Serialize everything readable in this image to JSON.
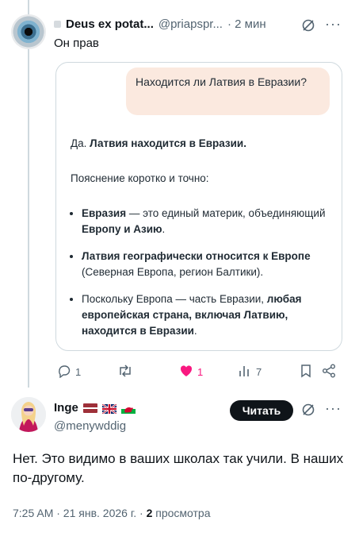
{
  "tweet1": {
    "author_name": "Deus ex potat...",
    "handle": "@priapspr...",
    "time": "· 2 мин",
    "replying": "Он прав",
    "question": "Находится ли Латвия в Евразии?",
    "answer": {
      "line1_prefix": "Да. ",
      "line1_bold": "Латвия находится в Евразии.",
      "intro": "Пояснение коротко и точно:",
      "bullet1_bold": "Евразия",
      "bullet1_text": " — это единый материк, объединяющий ",
      "bullet1_bold2": "Европу и Азию",
      "bullet1_end": ".",
      "bullet2_bold": "Латвия географически относится к Европе",
      "bullet2_text": " (Северная Европа, регион Балтики).",
      "bullet3_text": "Поскольку Европа — часть Евразии, ",
      "bullet3_bold": "любая европейская страна, включая Латвию, находится в Евразии",
      "bullet3_end": "."
    },
    "actions": {
      "replies": "1",
      "retweets": "",
      "likes": "1",
      "views": "7"
    }
  },
  "tweet2": {
    "author_name": "Inge",
    "handle": "@menywddig",
    "follow_label": "Читать",
    "text": "Нет. Это видимо в ваших школах так учили. В наших по-другому.",
    "time": "7:25 AM · 21 янв. 2026 г. · ",
    "views_count": "2",
    "views_label": " просмотра"
  },
  "colors": {
    "like": "#f91880",
    "secondary_text": "#536471",
    "bubble": "#fbe9df",
    "follow_bg": "#0f1419"
  },
  "icons": [
    "grok-icon",
    "more-icon",
    "reply-icon",
    "retweet-icon",
    "heart-icon",
    "views-icon",
    "bookmark-icon",
    "share-icon"
  ]
}
